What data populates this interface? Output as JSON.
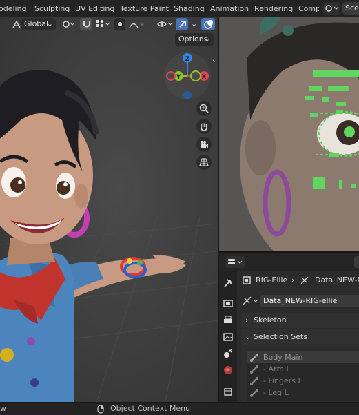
{
  "menu": {
    "tabs": [
      "odeling",
      "Sculpting",
      "UV Editing",
      "Texture Paint",
      "Shading",
      "Animation",
      "Rendering",
      "Compo"
    ],
    "scene_label": "Sce"
  },
  "viewport": {
    "transform_orientation": "Global",
    "options_label": "Options",
    "gizmo": {
      "z": "Z",
      "y": "Y",
      "x": "X"
    }
  },
  "properties": {
    "breadcrumb": {
      "object": "RIG-Ellie",
      "data": "Data_NEW-RIG"
    },
    "datablock_name": "Data_NEW-RIG-ellie",
    "panels": {
      "skeleton": "Skeleton",
      "selection_sets": "Selection Sets"
    },
    "selection_sets": [
      "Body Main",
      "- Arm L",
      "- Fingers L",
      "- Leg L"
    ]
  },
  "statusbar": {
    "left_text": "w",
    "context_menu": "Object Context Menu"
  },
  "colors": {
    "accent": "#4772b3",
    "axis_x": "#e44258",
    "axis_y": "#8ec225",
    "axis_z": "#2f87e6",
    "rig_green": "#5fd65f"
  }
}
